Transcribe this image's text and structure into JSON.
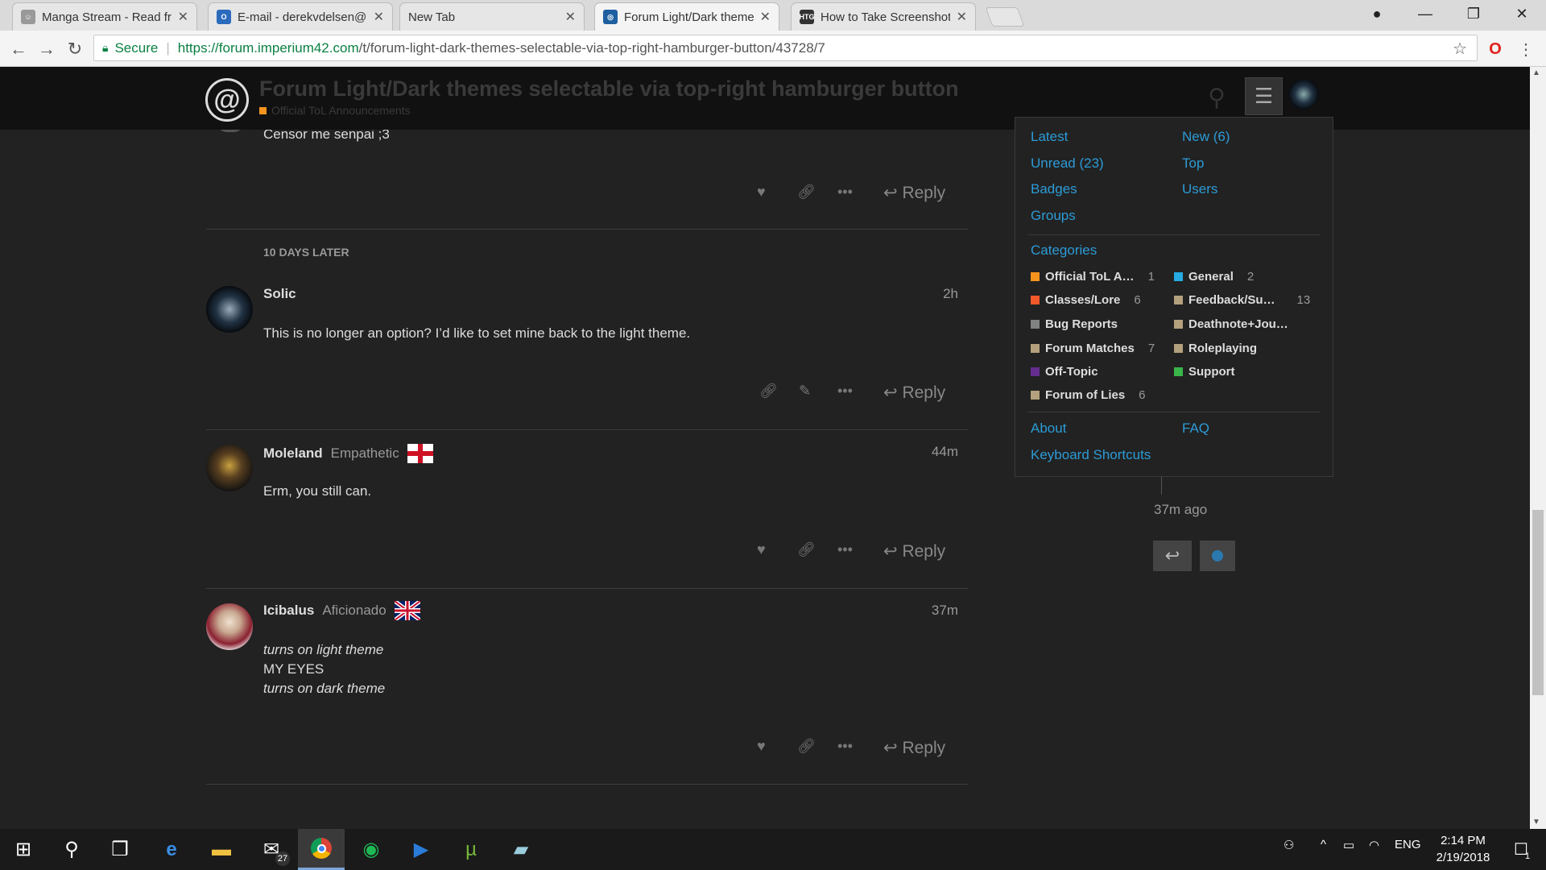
{
  "tabs": [
    {
      "title": "Manga Stream - Read fre",
      "icon": "manga-icon",
      "color": "#999999"
    },
    {
      "title": "E-mail - derekvdelsen@",
      "icon": "outlook-icon",
      "color": "#2b6bbd"
    },
    {
      "title": "New Tab",
      "icon": "",
      "color": ""
    },
    {
      "title": "Forum Light/Dark theme",
      "icon": "imperium-icon",
      "color": "#1e5fa0"
    },
    {
      "title": "How to Take Screenshots",
      "icon": "htg-icon",
      "color": "#333333"
    }
  ],
  "address_bar": {
    "secure_label": "Secure",
    "url_host": "https://forum.imperium42.com",
    "url_path": "/t/forum-light-dark-themes-selectable-via-top-right-hamburger-button/43728/7"
  },
  "header": {
    "title": "Forum Light/Dark themes selectable via top-right hamburger button",
    "category": "Official ToL Announcements"
  },
  "posts": {
    "partial_body": "Censor me senpai ;3",
    "gap_label": "10 DAYS LATER",
    "solic": {
      "username": "Solic",
      "time": "2h",
      "body": "This is no longer an option? I’d like to set mine back to the light theme."
    },
    "moleland": {
      "username": "Moleland",
      "title": "Empathetic",
      "time": "44m",
      "body": "Erm, you still can."
    },
    "icibalus": {
      "username": "Icibalus",
      "title": "Aficionado",
      "time": "37m",
      "line1": "turns on light theme",
      "line2": "MY EYES",
      "line3": "turns on dark theme"
    },
    "reply_label": "Reply"
  },
  "menu": {
    "latest": "Latest",
    "new": "New (6)",
    "unread": "Unread (23)",
    "top": "Top",
    "badges": "Badges",
    "users": "Users",
    "groups": "Groups",
    "categories_heading": "Categories",
    "categories": [
      {
        "name": "Official ToL A…",
        "count": "1",
        "color": "#f7941d"
      },
      {
        "name": "General",
        "count": "2",
        "color": "#25aae1"
      },
      {
        "name": "Classes/Lore",
        "count": "6",
        "color": "#f1592a"
      },
      {
        "name": "Feedback/Su…",
        "count": "13",
        "color": "#b3a07c"
      },
      {
        "name": "Bug Reports",
        "count": "",
        "color": "#808281"
      },
      {
        "name": "Deathnote+Jou…",
        "count": "",
        "color": "#b3a07c"
      },
      {
        "name": "Forum Matches",
        "count": "7",
        "color": "#b3a07c"
      },
      {
        "name": "Roleplaying",
        "count": "",
        "color": "#b3a07c"
      },
      {
        "name": "Off-Topic",
        "count": "",
        "color": "#652d90"
      },
      {
        "name": "Support",
        "count": "",
        "color": "#3ab54a"
      },
      {
        "name": "Forum of Lies",
        "count": "6",
        "color": "#b3a07c"
      }
    ],
    "about": "About",
    "faq": "FAQ",
    "shortcuts": "Keyboard Shortcuts"
  },
  "timeline": {
    "ago": "37m ago"
  },
  "taskbar": {
    "mail_badge": "27",
    "lang": "ENG",
    "time": "2:14 PM",
    "date": "2/19/2018",
    "notif_count": "1"
  }
}
